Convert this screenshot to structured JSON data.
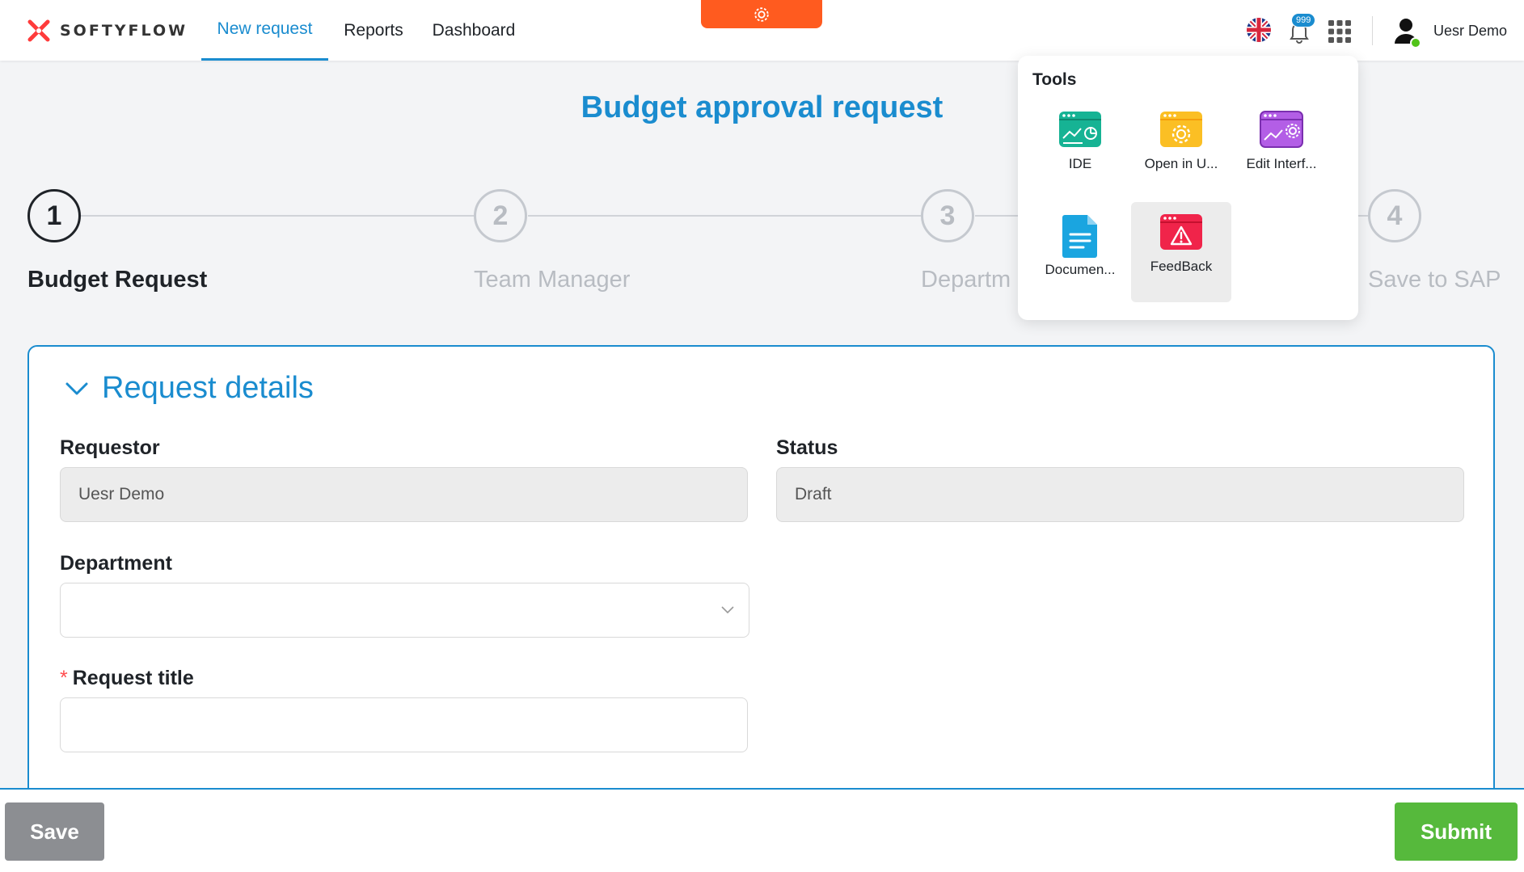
{
  "header": {
    "logo_text": "SOFTYFLOW",
    "tabs": [
      {
        "label": "New request",
        "active": true
      },
      {
        "label": "Reports",
        "active": false
      },
      {
        "label": "Dashboard",
        "active": false
      }
    ],
    "notification_count": "999",
    "user_name": "Uesr Demo",
    "icons": [
      "settings-gear-icon",
      "uk-flag-icon",
      "bell-icon",
      "apps-grid-icon",
      "user-avatar-icon"
    ],
    "accent": "#1a8ccf",
    "orange": "#ff5b1f"
  },
  "page": {
    "title": "Budget approval request"
  },
  "stepper": {
    "steps": [
      {
        "number": "1",
        "label": "Budget Request",
        "active": true
      },
      {
        "number": "2",
        "label": "Team Manager",
        "active": false
      },
      {
        "number": "3",
        "label": "Departm",
        "active": false
      },
      {
        "number": "4",
        "label": "Save to SAP",
        "active": false
      }
    ]
  },
  "form": {
    "section_title": "Request details",
    "requestor": {
      "label": "Requestor",
      "value": "Uesr Demo"
    },
    "status": {
      "label": "Status",
      "value": "Draft"
    },
    "department": {
      "label": "Department",
      "value": ""
    },
    "request_title": {
      "label": "Request title",
      "required_mark": "*",
      "value": ""
    }
  },
  "footer": {
    "save_label": "Save",
    "submit_label": "Submit"
  },
  "tools_menu": {
    "title": "Tools",
    "items": [
      {
        "label": "IDE",
        "icon": "ide-icon",
        "color": "#16b394"
      },
      {
        "label": "Open in U...",
        "icon": "open-in-ui-icon",
        "color": "#fbbf24"
      },
      {
        "label": "Edit Interf...",
        "icon": "edit-interface-icon",
        "color": "#b35ee6"
      },
      {
        "label": "Documen...",
        "icon": "document-icon",
        "color": "#1aa5e0"
      },
      {
        "label": "FeedBack",
        "icon": "feedback-icon",
        "color": "#f0244a"
      }
    ]
  }
}
